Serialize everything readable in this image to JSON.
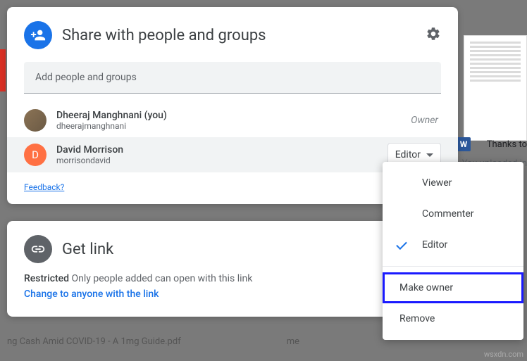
{
  "share_dialog": {
    "title": "Share with people and groups",
    "input_placeholder": "Add people and groups",
    "people": [
      {
        "name": "Dheeraj Manghnani (you)",
        "email": "dheerajmanghnani",
        "role": "Owner"
      },
      {
        "name": "David Morrison",
        "email": "morrisondavid",
        "role": "Editor",
        "avatar_initial": "D"
      }
    ],
    "feedback": "Feedback?"
  },
  "link_dialog": {
    "title": "Get link",
    "restricted_label": "Restricted",
    "restricted_desc": " Only people added can open with this link",
    "change_link": "Change to anyone with the link"
  },
  "role_menu": {
    "viewer": "Viewer",
    "commenter": "Commenter",
    "editor": "Editor",
    "make_owner": "Make owner",
    "remove": "Remove"
  },
  "background": {
    "file_name": "ng Cash Amid COVID-19 - A 1mg Guide.pdf",
    "file_owner": "me",
    "thanks": "Thanks to",
    "uploaded": "You uploaded in",
    "word_icon": "W",
    "watermark": "wsxdn.com"
  }
}
